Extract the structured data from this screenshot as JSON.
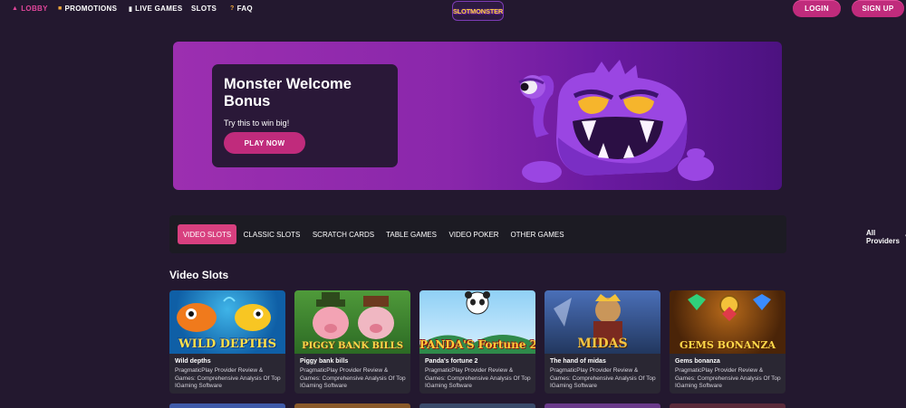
{
  "nav": {
    "items": [
      {
        "label": "LOBBY",
        "icon": "up-triangle-icon"
      },
      {
        "label": "PROMOTIONS",
        "icon": "gift-icon"
      },
      {
        "label": "LIVE GAMES",
        "icon": "phone-icon"
      },
      {
        "label": "SLOTS",
        "icon": ""
      },
      {
        "label": "FAQ",
        "icon": "question-icon"
      }
    ],
    "logo_text": "SLOTMONSTER",
    "login_label": "LOGIN",
    "signup_label": "SIGN UP"
  },
  "hero": {
    "title": "Monster Welcome Bonus",
    "subtitle": "Try this to win big!",
    "cta_label": "PLAY NOW"
  },
  "tabs": {
    "items": [
      "VIDEO SLOTS",
      "CLASSIC SLOTS",
      "SCRATCH CARDS",
      "TABLE GAMES",
      "VIDEO POKER",
      "OTHER GAMES"
    ],
    "active": "VIDEO SLOTS",
    "providers_label": "All Providers"
  },
  "section": {
    "title": "Video Slots"
  },
  "games": [
    {
      "name": "Wild depths",
      "art_title": "WILD DEPTHS",
      "desc": "PragmaticPlay Provider Review & Games: Comprehensive Analysis Of Top IGaming Software"
    },
    {
      "name": "Piggy bank bills",
      "art_title": "PIGGY BANK BILLS",
      "desc": "PragmaticPlay Provider Review & Games: Comprehensive Analysis Of Top IGaming Software"
    },
    {
      "name": "Panda's fortune 2",
      "art_title": "PANDA'S Fortune 2",
      "desc": "PragmaticPlay Provider Review & Games: Comprehensive Analysis Of Top IGaming Software"
    },
    {
      "name": "The hand of midas",
      "art_title": "MIDAS",
      "desc": "PragmaticPlay Provider Review & Games: Comprehensive Analysis Of Top IGaming Software"
    },
    {
      "name": "Gems bonanza",
      "art_title": "GEMS BONANZA",
      "desc": "PragmaticPlay Provider Review & Games: Comprehensive Analysis Of Top IGaming Software"
    }
  ],
  "colors": {
    "accent": "#c02b7c",
    "background": "#23182f",
    "tab_active": "#d8407f"
  }
}
